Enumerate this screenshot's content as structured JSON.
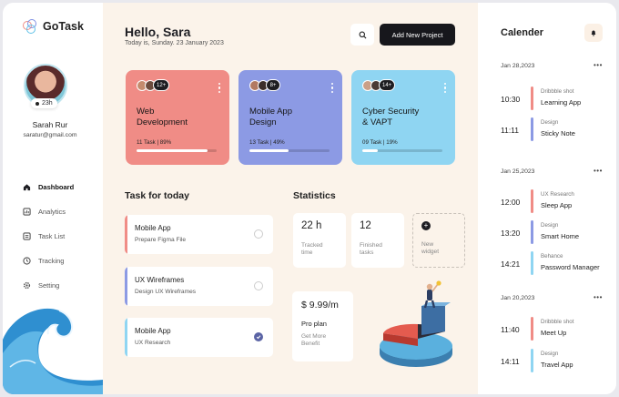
{
  "app": {
    "name": "GoTask"
  },
  "user": {
    "name": "Sarah Rur",
    "email": "saratur@gmail.com",
    "badge": "23h"
  },
  "nav": [
    {
      "label": "Dashboard",
      "icon": "home-icon",
      "active": true
    },
    {
      "label": "Analytics",
      "icon": "analytics-icon",
      "active": false
    },
    {
      "label": "Task List",
      "icon": "task-list-icon",
      "active": false
    },
    {
      "label": "Tracking",
      "icon": "clock-icon",
      "active": false
    },
    {
      "label": "Setting",
      "icon": "gear-icon",
      "active": false
    }
  ],
  "header": {
    "greeting": "Hello, Sara",
    "date": "Today is, Sunday. 23 January 2023",
    "add_button": "Add New Project"
  },
  "projects": [
    {
      "title_line1": "Web",
      "title_line2": "Development",
      "meta": "11 Task | 89%",
      "progress": 0.89,
      "members": "12+",
      "color": "#f08c86"
    },
    {
      "title_line1": "Mobile App",
      "title_line2": "Design",
      "meta": "13 Task | 49%",
      "progress": 0.49,
      "members": "8+",
      "color": "#8c9ae4"
    },
    {
      "title_line1": "Cyber Security",
      "title_line2": "& VAPT",
      "meta": "09 Task | 19%",
      "progress": 0.19,
      "members": "14+",
      "color": "#8fd5f2"
    }
  ],
  "tasks_title": "Task for today",
  "tasks": [
    {
      "name": "Mobile App",
      "sub": "Prepare Figma File",
      "done": false,
      "color": "#f08c86"
    },
    {
      "name": "UX Wireframes",
      "sub": "Design UX Wireframes",
      "done": false,
      "color": "#8c9ae4"
    },
    {
      "name": "Mobile App",
      "sub": "UX Research",
      "done": true,
      "color": "#8fd5f2"
    }
  ],
  "stats_title": "Statistics",
  "stats": [
    {
      "value": "22 h",
      "label_line1": "Tracked",
      "label_line2": "time"
    },
    {
      "value": "12",
      "label_line1": "Finished",
      "label_line2": "tasks"
    },
    {
      "value": "+",
      "label_line1": "New",
      "label_line2": "widget"
    }
  ],
  "plan": {
    "price": "$ 9.99/m",
    "name": "Pro plan",
    "sub_line1": "Get More",
    "sub_line2": "Benefit"
  },
  "calendar": {
    "title": "Calender",
    "more": "•••",
    "days": [
      {
        "date": "Jan 28,2023",
        "events": [
          {
            "time": "10:30",
            "category": "Dribbble shot",
            "name": "Learning App",
            "color": "#f08c86"
          },
          {
            "time": "11:11",
            "category": "Design",
            "name": "Sticky Note",
            "color": "#8c9ae4"
          }
        ]
      },
      {
        "date": "Jan 25,2023",
        "events": [
          {
            "time": "12:00",
            "category": "UX Research",
            "name": "Sleep App",
            "color": "#f08c86"
          },
          {
            "time": "13:20",
            "category": "Design",
            "name": "Smart Home",
            "color": "#8c9ae4"
          },
          {
            "time": "14:21",
            "category": "Behance",
            "name": "Password Manager",
            "color": "#8fd5f2"
          }
        ]
      },
      {
        "date": "Jan 20,2023",
        "events": [
          {
            "time": "11:40",
            "category": "Dribbble shot",
            "name": "Meet Up",
            "color": "#f08c86"
          },
          {
            "time": "14:11",
            "category": "Design",
            "name": "Travel App",
            "color": "#8fd5f2"
          }
        ]
      }
    ]
  }
}
